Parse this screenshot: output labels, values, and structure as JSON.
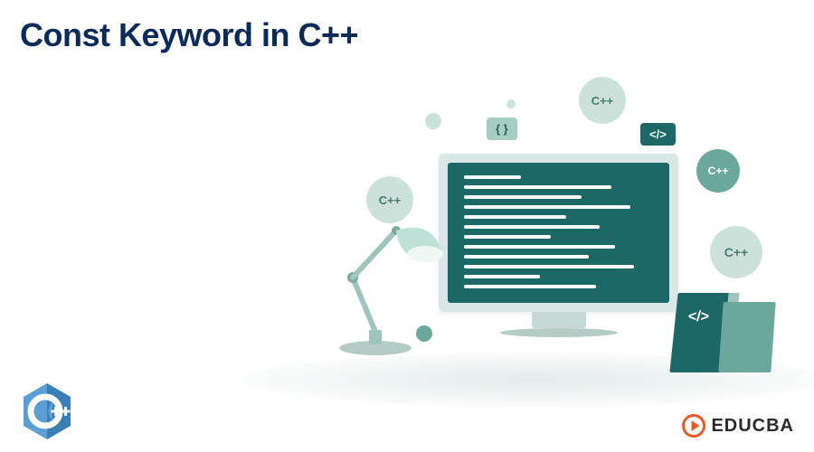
{
  "title": "Const Keyword in C++",
  "bubbles": {
    "cpp1": "C++",
    "cpp2": "C++",
    "cpp3": "C++",
    "cpp4": "C++"
  },
  "badges": {
    "braces": "{ }",
    "codeIcon": "</>"
  },
  "book": {
    "label": "</>"
  },
  "logos": {
    "cpp": "C++",
    "educba": "EDUCBA"
  }
}
